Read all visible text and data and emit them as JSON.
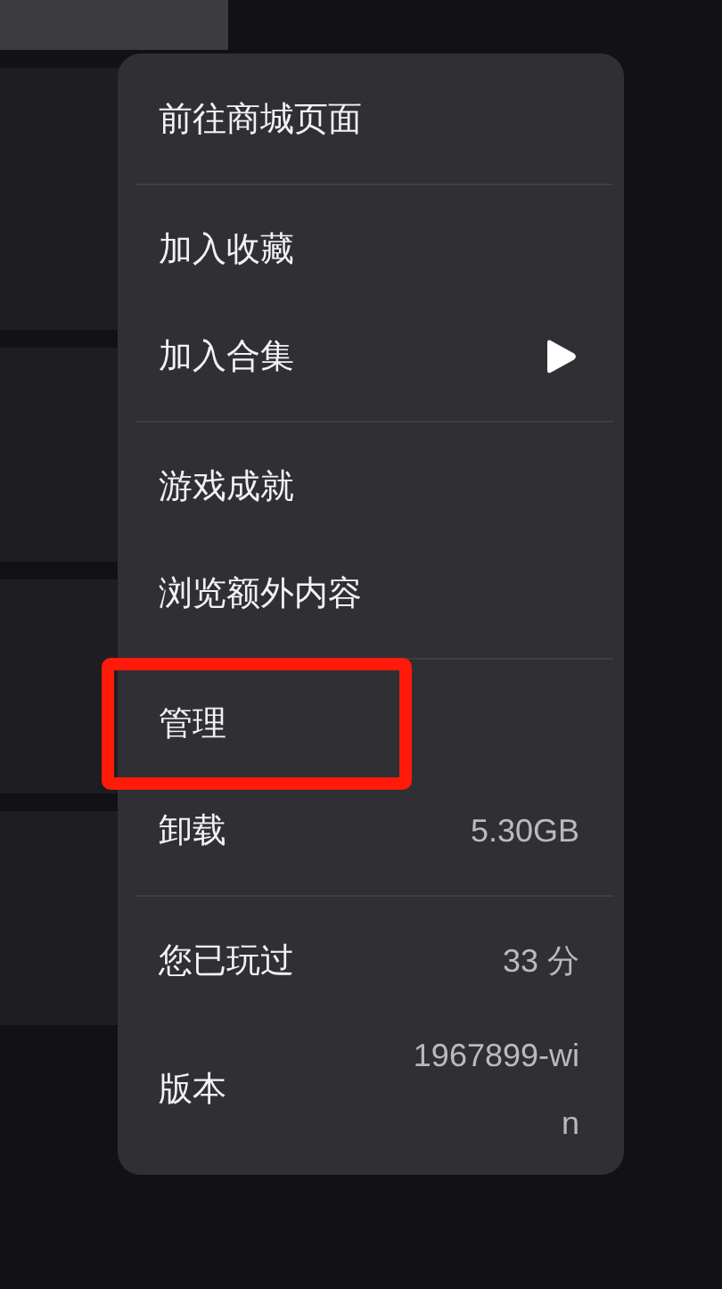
{
  "menu": {
    "sections": [
      {
        "items": [
          {
            "label": "前往商城页面",
            "has_submenu": false,
            "highlighted": false
          }
        ]
      },
      {
        "items": [
          {
            "label": "加入收藏",
            "has_submenu": false,
            "highlighted": false
          },
          {
            "label": "加入合集",
            "has_submenu": true,
            "highlighted": false
          }
        ]
      },
      {
        "items": [
          {
            "label": "游戏成就",
            "has_submenu": false,
            "highlighted": false
          },
          {
            "label": "浏览额外内容",
            "has_submenu": false,
            "highlighted": false
          }
        ]
      },
      {
        "items": [
          {
            "label": "管理",
            "has_submenu": false,
            "highlighted": true
          },
          {
            "label": "卸载",
            "value": "5.30GB",
            "has_submenu": false,
            "highlighted": false
          }
        ]
      },
      {
        "items": [
          {
            "label": "您已玩过",
            "value": "33 分",
            "has_submenu": false,
            "highlighted": false
          },
          {
            "label": "版本",
            "value": "1967899-win",
            "has_submenu": false,
            "highlighted": false
          }
        ]
      }
    ]
  }
}
